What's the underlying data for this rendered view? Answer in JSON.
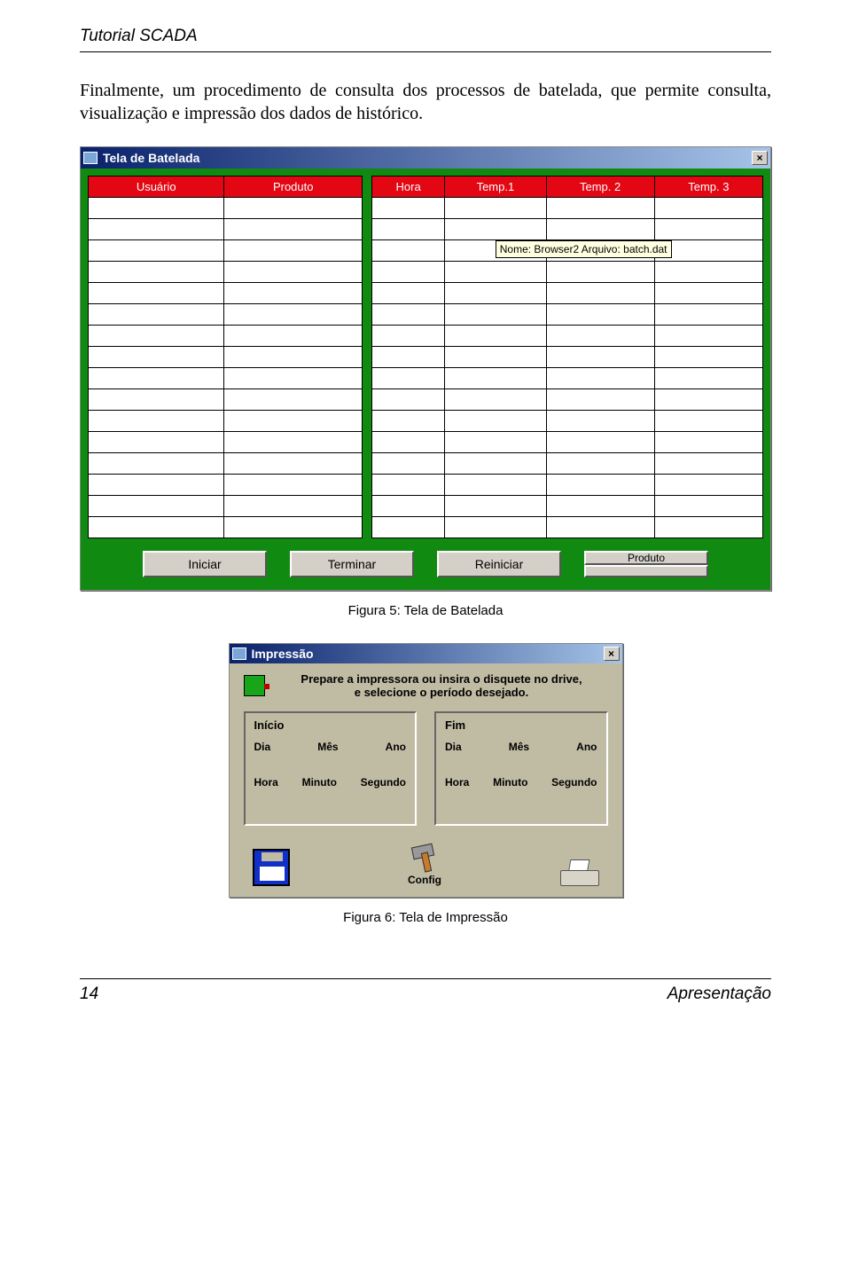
{
  "doc": {
    "header": "Tutorial SCADA",
    "paragraph": "Finalmente, um procedimento de consulta dos processos de batelada, que permite consulta, visualização e impressão dos dados de histórico.",
    "fig5": "Figura 5: Tela de Batelada",
    "fig6": "Figura 6: Tela de Impressão",
    "page_num": "14",
    "footer_right": "Apresentação"
  },
  "win1": {
    "title": "Tela de Batelada",
    "close": "×",
    "left_cols": [
      "Usuário",
      "Produto"
    ],
    "right_cols": [
      "Hora",
      "Temp.1",
      "Temp. 2",
      "Temp. 3"
    ],
    "tooltip": "Nome: Browser2  Arquivo: batch.dat",
    "buttons": {
      "iniciar": "Iniciar",
      "terminar": "Terminar",
      "reiniciar": "Reiniciar"
    },
    "produto_label": "Produto"
  },
  "win2": {
    "title": "Impressão",
    "close": "×",
    "instr_l1": "Prepare a impressora ou insira o disquete no drive,",
    "instr_l2": "e selecione o período desejado.",
    "inicio": "Início",
    "fim": "Fim",
    "labels1": {
      "dia": "Dia",
      "mes": "Mês",
      "ano": "Ano"
    },
    "labels2": {
      "hora": "Hora",
      "min": "Minuto",
      "seg": "Segundo"
    },
    "config": "Config"
  }
}
